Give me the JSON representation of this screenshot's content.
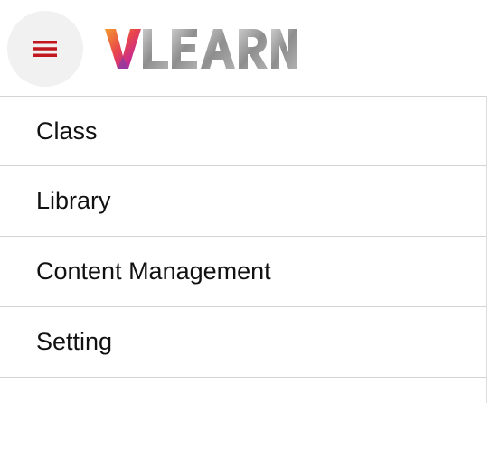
{
  "header": {
    "menu_icon": "hamburger-menu-icon",
    "logo_text": "VLEARN",
    "colors": {
      "menu_icon": "#c0181e",
      "menu_button_bg": "#f1f1f1",
      "logo_gray": "#9a9a9a"
    }
  },
  "nav": {
    "items": [
      {
        "label": "Class"
      },
      {
        "label": "Library"
      },
      {
        "label": "Content Management"
      },
      {
        "label": "Setting"
      }
    ]
  }
}
